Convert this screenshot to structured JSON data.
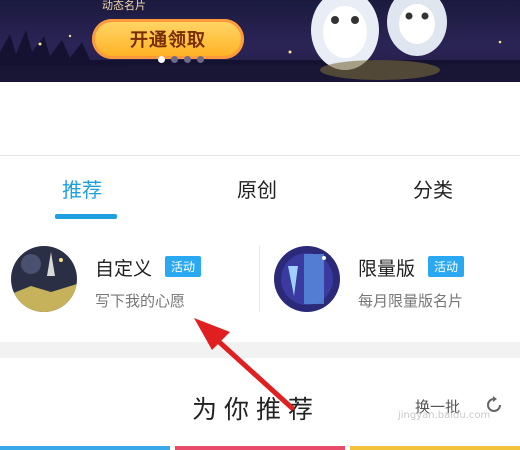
{
  "banner": {
    "caption": "动态名片",
    "button_label": "开通领取",
    "carousel_pages": 4,
    "carousel_active": 1
  },
  "tabs": [
    {
      "label": "推荐",
      "active": true
    },
    {
      "label": "原创",
      "active": false
    },
    {
      "label": "分类",
      "active": false
    }
  ],
  "cards": [
    {
      "title": "自定义",
      "badge": "活动",
      "subtitle": "写下我的心愿"
    },
    {
      "title": "限量版",
      "badge": "活动",
      "subtitle": "每月限量版名片"
    }
  ],
  "recommend": {
    "title": "为你推荐",
    "refresh_label": "换一批"
  },
  "watermark": "jingyan.baidu.com",
  "colors": {
    "accent": "#1f9fe0",
    "badge": "#2aa8f2",
    "annotation_arrow": "#e02020"
  }
}
